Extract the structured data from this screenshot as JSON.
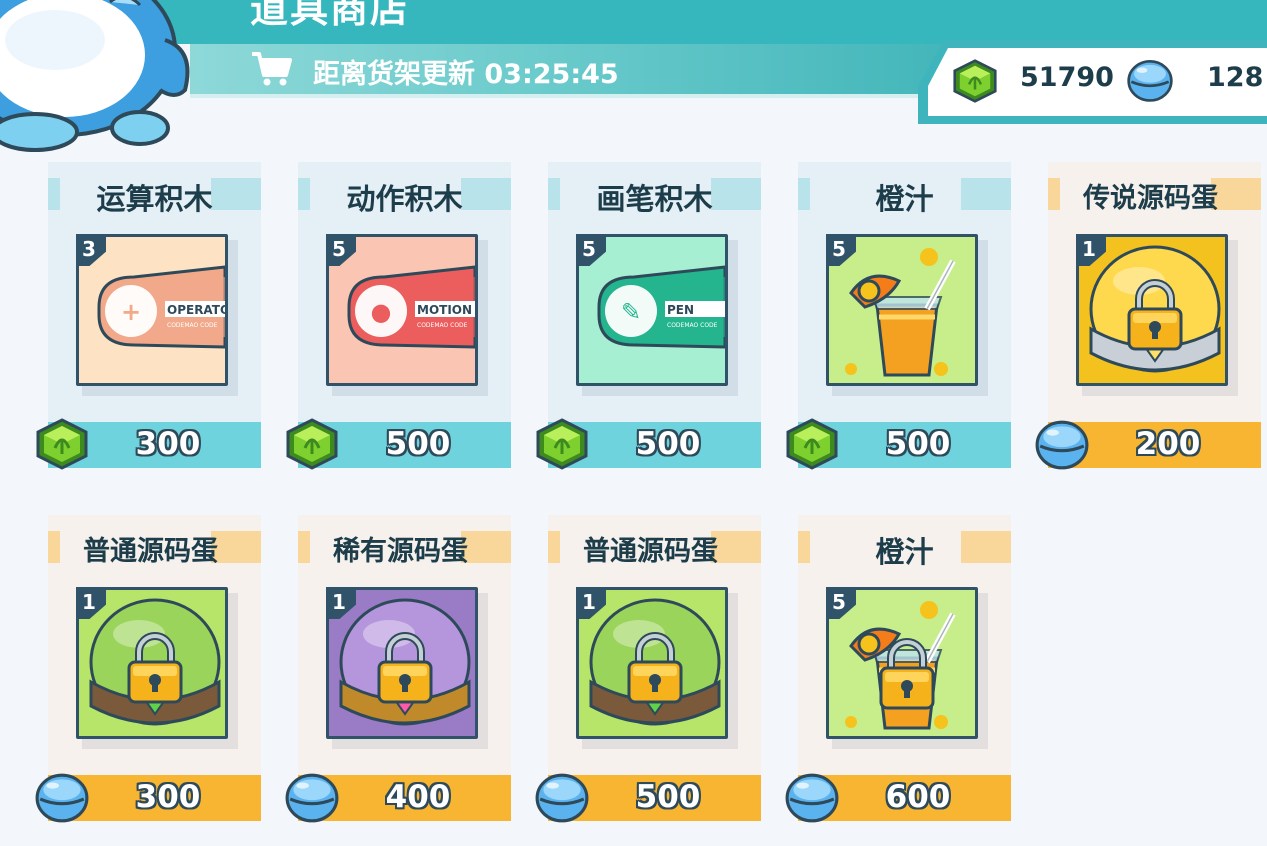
{
  "header": {
    "title": "道具商店",
    "refresh_text": "距离货架更新 03:25:45",
    "gems": "51790",
    "balls": "128"
  },
  "colors": {
    "teal_header": "#36b7bd",
    "teal_price": "#6fd3dd",
    "orange_price": "#f8b531",
    "text_dark": "#1d3d4a"
  },
  "items": [
    {
      "name": "运算积木",
      "level": "3",
      "price": "300",
      "currency": "gem-icon",
      "theme": "teal",
      "art": "operator-block"
    },
    {
      "name": "动作积木",
      "level": "5",
      "price": "500",
      "currency": "gem-icon",
      "theme": "teal",
      "art": "motion-block"
    },
    {
      "name": "画笔积木",
      "level": "5",
      "price": "500",
      "currency": "gem-icon",
      "theme": "teal",
      "art": "pen-block"
    },
    {
      "name": "橙汁",
      "level": "5",
      "price": "500",
      "currency": "gem-icon",
      "theme": "teal",
      "art": "orange-juice"
    },
    {
      "name": "传说源码蛋",
      "level": "1",
      "price": "200",
      "currency": "ball-icon",
      "theme": "orange",
      "art": "legendary-egg-locked"
    },
    {
      "name": "普通源码蛋",
      "level": "1",
      "price": "300",
      "currency": "ball-icon",
      "theme": "orange",
      "art": "common-egg-locked"
    },
    {
      "name": "稀有源码蛋",
      "level": "1",
      "price": "400",
      "currency": "ball-icon",
      "theme": "orange",
      "art": "rare-egg-locked"
    },
    {
      "name": "普通源码蛋",
      "level": "1",
      "price": "500",
      "currency": "ball-icon",
      "theme": "orange",
      "art": "common-egg-locked"
    },
    {
      "name": "橙汁",
      "level": "5",
      "price": "600",
      "currency": "ball-icon",
      "theme": "orange",
      "art": "orange-juice-locked"
    }
  ],
  "block_labels": {
    "operator": "OPERATO",
    "motion": "MOTION",
    "pen": "PEN",
    "sub": "CODEMAO CODE"
  }
}
